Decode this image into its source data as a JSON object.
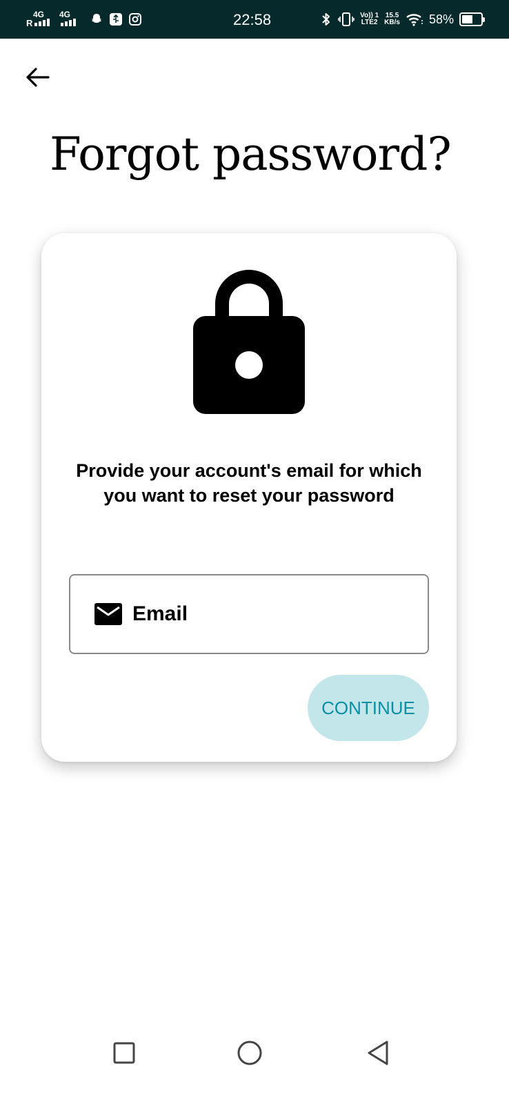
{
  "status_bar": {
    "signal1_label": "4G",
    "roaming_label": "R",
    "signal2_label": "4G",
    "time": "22:58",
    "volte_label": "Vo)) 1",
    "lte_label": "LTE2",
    "speed_value": "15.5",
    "speed_unit": "KB/s",
    "battery_text": "58%",
    "battery_level": 0.58,
    "icons": [
      "snapchat-icon",
      "usb-debug-icon",
      "instagram-icon",
      "bluetooth-icon",
      "vibrate-icon",
      "wifi-icon",
      "battery-icon"
    ]
  },
  "header": {
    "back_icon": "arrow-left-icon",
    "title": "Forgot password?"
  },
  "card": {
    "icon": "lock-icon",
    "description": "Provide your account's email for which you want to reset your password",
    "email_field": {
      "icon": "mail-icon",
      "placeholder": "Email",
      "value": ""
    },
    "continue_label": "CONTINUE"
  },
  "nav": {
    "icons": [
      "recents-square-icon",
      "home-circle-icon",
      "back-triangle-icon"
    ]
  },
  "colors": {
    "status_bar_bg": "#062a2c",
    "button_bg": "#c3e6ea",
    "button_text": "#0a8fa6"
  }
}
